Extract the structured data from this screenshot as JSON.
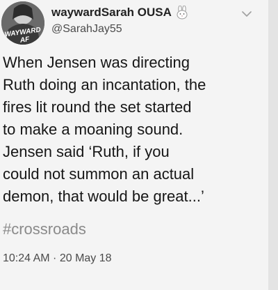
{
  "tweet": {
    "display_name": "waywardSarah OUSA",
    "handle": "@SarahJay55",
    "avatar_text": "WAYWARD AF",
    "body": "When Jensen was directing\nRuth doing an incantation, the\nfires lit round the set started\nto make a moaning sound.\nJensen said ‘Ruth, if you\ncould not summon an actual\ndemon, that would be great...’",
    "hashtag": "#crossroads",
    "timestamp": "10:24 AM · 20 May 18"
  },
  "icons": {
    "name_badge": "bunny-emoji-icon",
    "menu": "chevron-down-icon"
  },
  "colors": {
    "background": "#f4f4f4",
    "text": "#161616",
    "secondary_text": "#4a4a4a",
    "hashtag": "#8a8a8a"
  }
}
